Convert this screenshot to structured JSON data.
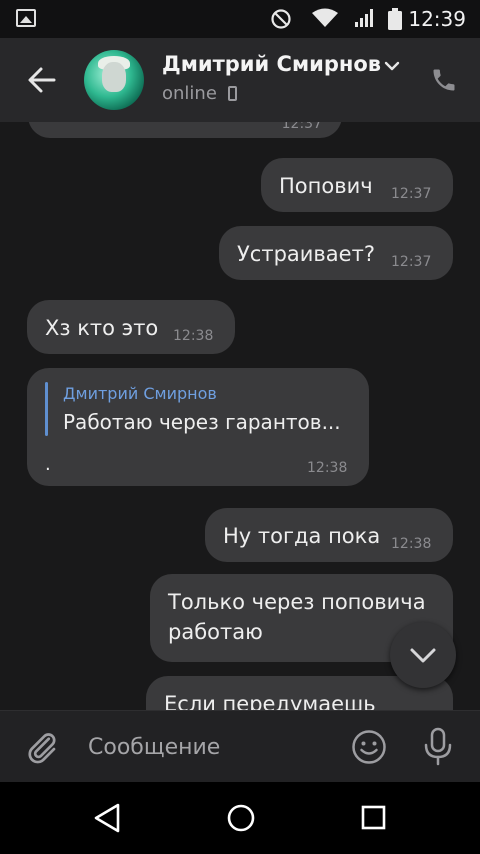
{
  "status_bar": {
    "time": "12:39",
    "icons": [
      "image-icon",
      "do-not-disturb-icon",
      "wifi-icon",
      "signal-icon",
      "battery-icon"
    ]
  },
  "header": {
    "contact_name": "Дмитрий Смирнов",
    "status": "online",
    "icons": [
      "back-arrow-icon",
      "chevron-down-icon",
      "mobile-device-icon",
      "phone-call-icon"
    ]
  },
  "messages": [
    {
      "side": "in",
      "text": "",
      "time": "12:37"
    },
    {
      "side": "out",
      "text": "Попович",
      "time": "12:37"
    },
    {
      "side": "out",
      "text": "Устраивает?",
      "time": "12:37"
    },
    {
      "side": "in",
      "text": "Хз кто это",
      "time": "12:38"
    },
    {
      "side": "in",
      "reply_author": "Дмитрий Смирнов",
      "reply_text": "Работаю через гарантов...",
      "text": ".",
      "time": "12:38"
    },
    {
      "side": "out",
      "text": "Ну тогда пока",
      "time": "12:38"
    },
    {
      "side": "out",
      "text_line1": "Только через поповича",
      "text_line2": "работаю",
      "time": ""
    },
    {
      "side": "out",
      "text": "Если передумаешь",
      "time": ""
    }
  ],
  "composer": {
    "placeholder": "Сообщение",
    "icons": [
      "paperclip-icon",
      "emoji-icon",
      "microphone-icon"
    ]
  },
  "scroll_down": {
    "icon": "chevron-down-icon"
  },
  "nav_bar": {
    "icons": [
      "back-triangle-icon",
      "home-circle-icon",
      "recents-square-icon"
    ]
  },
  "colors": {
    "background": "#19191a",
    "header": "#28282a",
    "bubble": "#3a3a3c",
    "reply_accent": "#6f9fe0"
  }
}
